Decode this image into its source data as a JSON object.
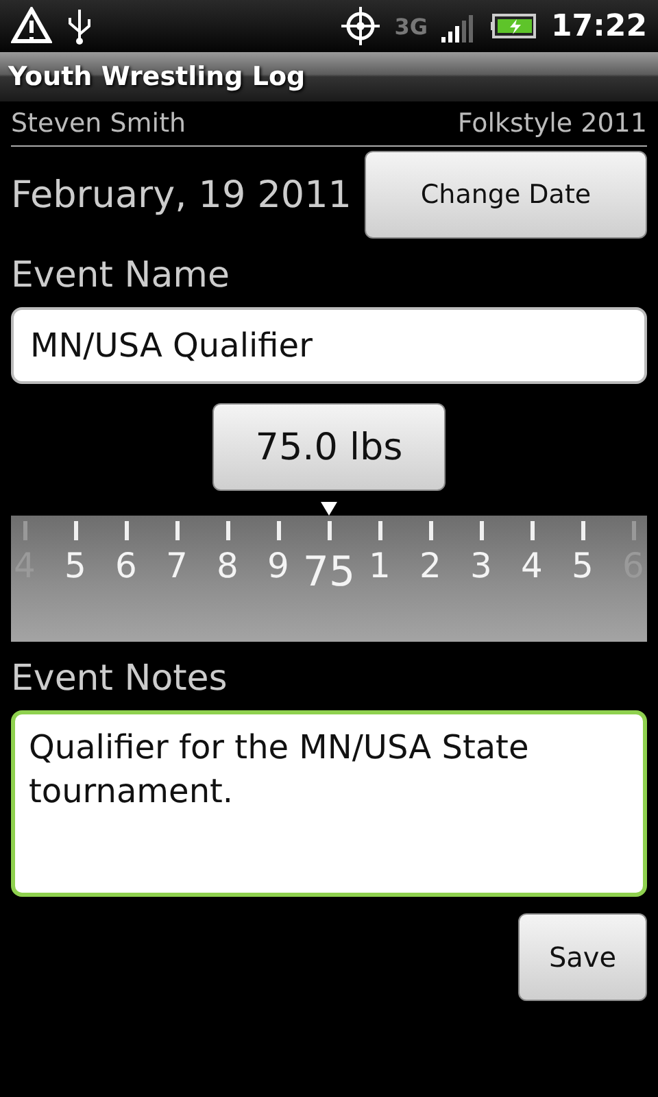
{
  "status_bar": {
    "network": "3G",
    "time": "17:22"
  },
  "title_bar": {
    "title": "Youth Wrestling Log"
  },
  "header": {
    "name": "Steven Smith",
    "season": "Folkstyle 2011"
  },
  "date": {
    "text": "February, 19 2011",
    "button": "Change Date"
  },
  "event_name": {
    "label": "Event Name",
    "value": "MN/USA Qualifier"
  },
  "weight": {
    "button": "75.0 lbs"
  },
  "ruler": [
    {
      "label": "4",
      "faded": true,
      "selected": false
    },
    {
      "label": "5",
      "faded": false,
      "selected": false
    },
    {
      "label": "6",
      "faded": false,
      "selected": false
    },
    {
      "label": "7",
      "faded": false,
      "selected": false
    },
    {
      "label": "8",
      "faded": false,
      "selected": false
    },
    {
      "label": "9",
      "faded": false,
      "selected": false
    },
    {
      "label": "75",
      "faded": false,
      "selected": true
    },
    {
      "label": "1",
      "faded": false,
      "selected": false
    },
    {
      "label": "2",
      "faded": false,
      "selected": false
    },
    {
      "label": "3",
      "faded": false,
      "selected": false
    },
    {
      "label": "4",
      "faded": false,
      "selected": false
    },
    {
      "label": "5",
      "faded": false,
      "selected": false
    },
    {
      "label": "6",
      "faded": true,
      "selected": false
    }
  ],
  "event_notes": {
    "label": "Event Notes",
    "value": "Qualifier for the MN/USA State tournament.",
    "focused": true
  },
  "buttons": {
    "save": "Save"
  }
}
